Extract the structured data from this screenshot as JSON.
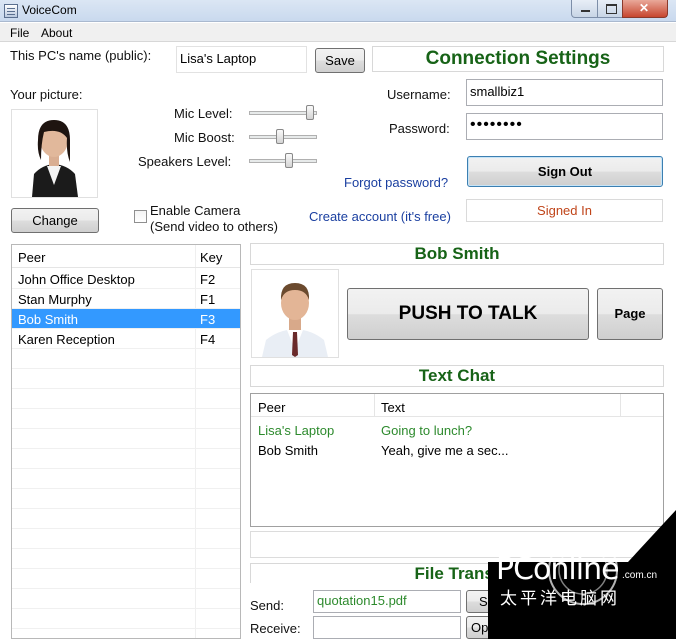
{
  "window": {
    "title": "VoiceCom"
  },
  "menu": {
    "items": [
      "File",
      "About"
    ]
  },
  "profile": {
    "pc_name_label": "This PC's name (public):",
    "pc_name_value": "Lisa's Laptop",
    "save_label": "Save",
    "picture_label": "Your picture:",
    "change_label": "Change",
    "enable_camera_label": "Enable Camera",
    "enable_camera_sub": "(Send video to others)",
    "enable_camera_checked": false
  },
  "audio": {
    "mic_level_label": "Mic Level:",
    "mic_level": 0.95,
    "mic_boost_label": "Mic Boost:",
    "mic_boost": 0.45,
    "speakers_label": "Speakers Level:",
    "speakers": 0.6
  },
  "connection": {
    "header": "Connection Settings",
    "username_label": "Username:",
    "username_value": "smallbiz1",
    "password_label": "Password:",
    "password_value": "••••••••",
    "sign_out_label": "Sign Out",
    "forgot_label": "Forgot password?",
    "create_label": "Create account (it's free)",
    "status": "Signed In",
    "status_color": "#c0451a"
  },
  "peers": {
    "columns": [
      "Peer",
      "Key"
    ],
    "rows": [
      {
        "peer": "John Office Desktop",
        "key": "F2"
      },
      {
        "peer": "Stan Murphy",
        "key": "F1"
      },
      {
        "peer": "Bob Smith",
        "key": "F3",
        "selected": true
      },
      {
        "peer": "Karen Reception",
        "key": "F4"
      }
    ]
  },
  "contact": {
    "name": "Bob Smith",
    "push_to_talk_label": "PUSH TO TALK",
    "page_label": "Page"
  },
  "chat": {
    "header": "Text Chat",
    "columns": [
      "Peer",
      "Text"
    ],
    "rows": [
      {
        "peer": "Lisa's Laptop",
        "text": "Going to lunch?",
        "color": "#2d8a2d"
      },
      {
        "peer": "Bob Smith",
        "text": "Yeah, give me a sec...",
        "color": "#000000"
      }
    ]
  },
  "file_transfer": {
    "header": "File Transf",
    "send_label": "Send:",
    "send_value": "quotation15.pdf",
    "send_button": "Se",
    "receive_label": "Receive:",
    "receive_value": "",
    "open_button": "Op"
  },
  "watermark": {
    "text": "PConline",
    "domain": ".com.cn",
    "chinese": "太平洋电脑网"
  },
  "colors": {
    "accent_green": "#176317",
    "selection": "#3399ff",
    "link": "#1a3fa0"
  }
}
